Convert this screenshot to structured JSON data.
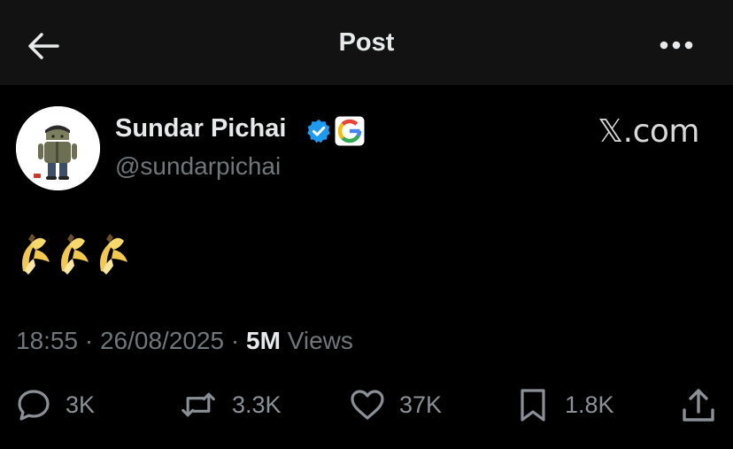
{
  "header": {
    "title": "Post"
  },
  "post": {
    "author_name": "Sundar Pichai",
    "handle": "@sundarpichai",
    "brand": "𝕏.com",
    "content_emojis": [
      "banana",
      "banana",
      "banana"
    ],
    "time": "18:55",
    "separator": "·",
    "date": "26/08/2025",
    "views_count": "5M",
    "views_label": "Views"
  },
  "actions": {
    "replies": "3K",
    "reposts": "3.3K",
    "likes": "37K",
    "bookmarks": "1.8K"
  },
  "colors": {
    "background": "#000000",
    "header_bg": "#121212",
    "text_primary": "#e7e9ea",
    "text_secondary": "#71767b",
    "verified_blue": "#1d9bf0"
  },
  "icons": [
    "arrow-left-icon",
    "more-horizontal-icon",
    "verified-badge-icon",
    "google-logo-icon",
    "reply-icon",
    "repost-icon",
    "like-icon",
    "bookmark-icon",
    "share-icon"
  ]
}
